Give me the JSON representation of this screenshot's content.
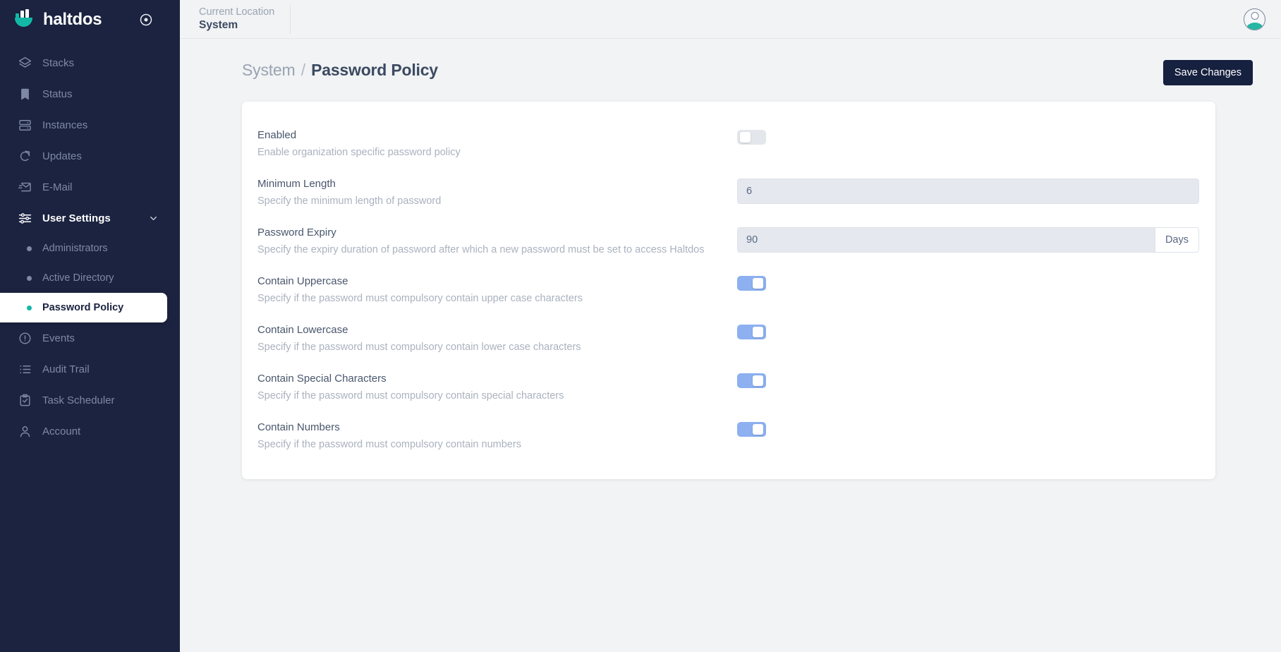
{
  "brand": {
    "name": "haltdos",
    "logo_icon": "haltdos-logo-icon",
    "target_icon": "target-icon",
    "teal": "#13b8a6",
    "navy": "#1b2340"
  },
  "sidebar": {
    "items": [
      {
        "label": "Stacks",
        "icon": "layers-icon",
        "active": false
      },
      {
        "label": "Status",
        "icon": "bookmark-icon",
        "active": false
      },
      {
        "label": "Instances",
        "icon": "server-icon",
        "active": false
      },
      {
        "label": "Updates",
        "icon": "refresh-icon",
        "active": false
      },
      {
        "label": "E-Mail",
        "icon": "mail-icon",
        "active": false
      },
      {
        "label": "User Settings",
        "icon": "sliders-icon",
        "active": false,
        "expanded": true
      },
      {
        "label": "Events",
        "icon": "alert-circle-icon",
        "active": false
      },
      {
        "label": "Audit Trail",
        "icon": "list-icon",
        "active": false
      },
      {
        "label": "Task Scheduler",
        "icon": "clipboard-check-icon",
        "active": false
      },
      {
        "label": "Account",
        "icon": "user-icon",
        "active": false
      }
    ],
    "sub_items": [
      {
        "label": "Administrators",
        "active": false
      },
      {
        "label": "Active Directory",
        "active": false
      },
      {
        "label": "Password Policy",
        "active": true
      }
    ]
  },
  "topbar": {
    "location_label": "Current Location",
    "location_value": "System",
    "avatar_icon": "user-avatar-icon"
  },
  "page": {
    "breadcrumb_parent": "System",
    "breadcrumb_separator": "/",
    "breadcrumb_current": "Password Policy",
    "save_label": "Save Changes"
  },
  "form": {
    "rows": [
      {
        "title": "Enabled",
        "desc": "Enable organization specific password policy",
        "control": "toggle",
        "value": "off"
      },
      {
        "title": "Minimum Length",
        "desc": "Specify the minimum length of password",
        "control": "input",
        "value": "6"
      },
      {
        "title": "Password Expiry",
        "desc": "Specify the expiry duration of password after which a new password must be set to access Haltdos",
        "control": "input-addon",
        "value": "90",
        "addon": "Days"
      },
      {
        "title": "Contain Uppercase",
        "desc": "Specify if the password must compulsory contain upper case characters",
        "control": "toggle",
        "value": "on"
      },
      {
        "title": "Contain Lowercase",
        "desc": "Specify if the password must compulsory contain lower case characters",
        "control": "toggle",
        "value": "on"
      },
      {
        "title": "Contain Special Characters",
        "desc": "Specify if the password must compulsory contain special characters",
        "control": "toggle",
        "value": "on"
      },
      {
        "title": "Contain Numbers",
        "desc": "Specify if the password must compulsory contain numbers",
        "control": "toggle",
        "value": "on"
      }
    ]
  }
}
